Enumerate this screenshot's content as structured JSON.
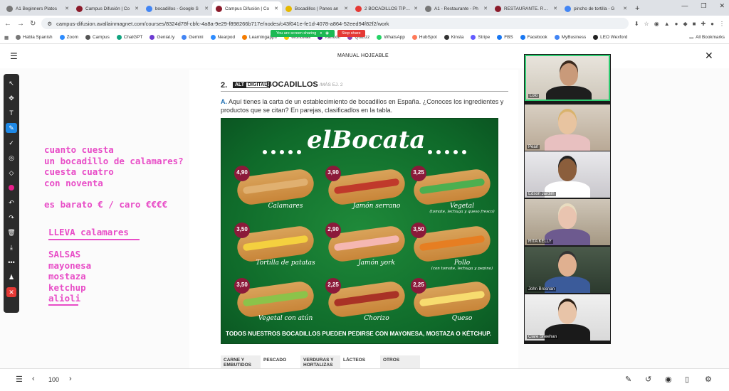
{
  "tabs": [
    {
      "label": "A1 Beginners Platos",
      "color": "#777"
    },
    {
      "label": "Campus Difusión | Co",
      "color": "#8b1a2a"
    },
    {
      "label": "bocadillos - Google S",
      "color": "#4285f4"
    },
    {
      "label": "Campus Difusión | Co",
      "color": "#8b1a2a",
      "active": true
    },
    {
      "label": "Bocadillos | Panes an",
      "color": "#e6b800"
    },
    {
      "label": "2 BOCADILLOS TÍPICO",
      "color": "#e53935"
    },
    {
      "label": "A1 - Restaurante - Ph",
      "color": "#777"
    },
    {
      "label": "RESTAURANTE. RELL",
      "color": "#8b1a2a"
    },
    {
      "label": "pincho de tortilla - G",
      "color": "#4285f4"
    }
  ],
  "address": {
    "url": "campus-difusion.avallainmagnet.com/courses/8324d78f-cbfc-4a8a-9e29-f898266b717e/nodes/c43f041e-fe1d-4078-a864-52eed94f82f2/work"
  },
  "bookmarks": [
    "Habla Spanish",
    "Zoom",
    "Campus",
    "ChatGPT",
    "Genial.ly",
    "Gemini",
    "Nearpod",
    "Learningapps",
    "Worldwall",
    "Kahoot!",
    "Quizizz",
    "WhatsApp",
    "HubSpot",
    "Kinsta",
    "Stripe",
    "FBS",
    "Facebook",
    "MyBusiness",
    "LEO Wexford"
  ],
  "all_bookmarks": "All Bookmarks",
  "sharing": {
    "text": "You are screen sharing",
    "stop": "Stop share"
  },
  "header": {
    "title": "MANUAL HOJEABLE"
  },
  "annotations": [
    "cuanto cuesta\nun bocadillo de calamares?\ncuesta cuatro\ncon noventa",
    "es barato € / caro €€€€",
    "LLEVA calamares",
    "SALSAS\nmayonesa\nmostaza\nketchup\nalioli"
  ],
  "exercise": {
    "number": "2.",
    "badge_alt": "ALT",
    "badge_digital": "DIGITAL",
    "title": "BOCADILLOS",
    "more": "/MÁS EJ. 2",
    "letter": "A.",
    "instructions": "Aquí tienes la carta de un establecimiento de bocadillos en España. ¿Conoces los ingredientes y productos que se citan? En parejas, clasificadlos en la tabla."
  },
  "poster": {
    "brand": "elBocata",
    "footer": "TODOS NUESTROS BOCADILLOS PUEDEN PEDIRSE CON MAYONESA, MOSTAZA O KÉTCHUP.",
    "items": [
      {
        "name": "Calamares",
        "sub": "",
        "price": "4,90",
        "fill": "#e0b070"
      },
      {
        "name": "Jamón serrano",
        "sub": "",
        "price": "3,90",
        "fill": "#c0392b"
      },
      {
        "name": "Vegetal",
        "sub": "(tomate, lechuga y queso fresco)",
        "price": "3,25",
        "fill": "#4caf50"
      },
      {
        "name": "Tortilla de patatas",
        "sub": "",
        "price": "3,50",
        "fill": "#f4d03f"
      },
      {
        "name": "Jamón york",
        "sub": "",
        "price": "2,90",
        "fill": "#f5b7b1"
      },
      {
        "name": "Pollo",
        "sub": "(con tomate, lechuga y pepino)",
        "price": "3,50",
        "fill": "#e67e22"
      },
      {
        "name": "Vegetal con atún",
        "sub": "",
        "price": "3,50",
        "fill": "#8bc34a"
      },
      {
        "name": "Chorizo",
        "sub": "",
        "price": "2,25",
        "fill": "#a93226"
      },
      {
        "name": "Queso",
        "sub": "",
        "price": "2,25",
        "fill": "#f7dc6f"
      }
    ]
  },
  "table_headers": [
    "CARNE Y EMBUTIDOS",
    "PESCADO",
    "VERDURAS Y HORTALIZAS",
    "LÁCTEOS",
    "OTROS"
  ],
  "participants": [
    "Lolo",
    "Pearl",
    "Edson Jardim",
    "RITA KELLY",
    "John Brosnan",
    "Clare Sheehan"
  ],
  "zoom": "100"
}
